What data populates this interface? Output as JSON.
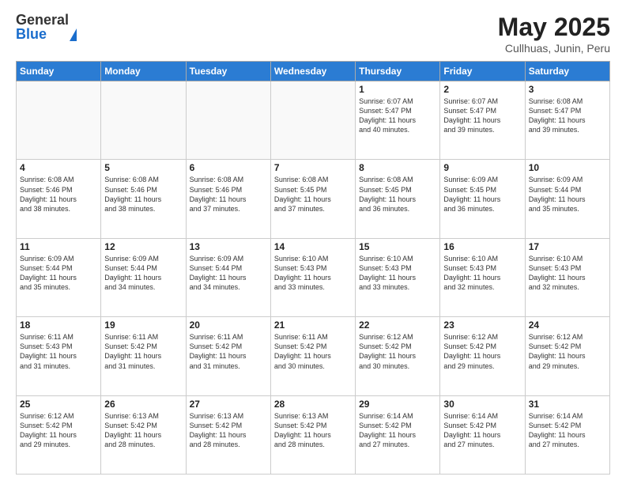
{
  "header": {
    "logo_general": "General",
    "logo_blue": "Blue",
    "month_title": "May 2025",
    "subtitle": "Cullhuas, Junin, Peru"
  },
  "days_of_week": [
    "Sunday",
    "Monday",
    "Tuesday",
    "Wednesday",
    "Thursday",
    "Friday",
    "Saturday"
  ],
  "weeks": [
    [
      {
        "day": "",
        "info": ""
      },
      {
        "day": "",
        "info": ""
      },
      {
        "day": "",
        "info": ""
      },
      {
        "day": "",
        "info": ""
      },
      {
        "day": "1",
        "info": "Sunrise: 6:07 AM\nSunset: 5:47 PM\nDaylight: 11 hours\nand 40 minutes."
      },
      {
        "day": "2",
        "info": "Sunrise: 6:07 AM\nSunset: 5:47 PM\nDaylight: 11 hours\nand 39 minutes."
      },
      {
        "day": "3",
        "info": "Sunrise: 6:08 AM\nSunset: 5:47 PM\nDaylight: 11 hours\nand 39 minutes."
      }
    ],
    [
      {
        "day": "4",
        "info": "Sunrise: 6:08 AM\nSunset: 5:46 PM\nDaylight: 11 hours\nand 38 minutes."
      },
      {
        "day": "5",
        "info": "Sunrise: 6:08 AM\nSunset: 5:46 PM\nDaylight: 11 hours\nand 38 minutes."
      },
      {
        "day": "6",
        "info": "Sunrise: 6:08 AM\nSunset: 5:46 PM\nDaylight: 11 hours\nand 37 minutes."
      },
      {
        "day": "7",
        "info": "Sunrise: 6:08 AM\nSunset: 5:45 PM\nDaylight: 11 hours\nand 37 minutes."
      },
      {
        "day": "8",
        "info": "Sunrise: 6:08 AM\nSunset: 5:45 PM\nDaylight: 11 hours\nand 36 minutes."
      },
      {
        "day": "9",
        "info": "Sunrise: 6:09 AM\nSunset: 5:45 PM\nDaylight: 11 hours\nand 36 minutes."
      },
      {
        "day": "10",
        "info": "Sunrise: 6:09 AM\nSunset: 5:44 PM\nDaylight: 11 hours\nand 35 minutes."
      }
    ],
    [
      {
        "day": "11",
        "info": "Sunrise: 6:09 AM\nSunset: 5:44 PM\nDaylight: 11 hours\nand 35 minutes."
      },
      {
        "day": "12",
        "info": "Sunrise: 6:09 AM\nSunset: 5:44 PM\nDaylight: 11 hours\nand 34 minutes."
      },
      {
        "day": "13",
        "info": "Sunrise: 6:09 AM\nSunset: 5:44 PM\nDaylight: 11 hours\nand 34 minutes."
      },
      {
        "day": "14",
        "info": "Sunrise: 6:10 AM\nSunset: 5:43 PM\nDaylight: 11 hours\nand 33 minutes."
      },
      {
        "day": "15",
        "info": "Sunrise: 6:10 AM\nSunset: 5:43 PM\nDaylight: 11 hours\nand 33 minutes."
      },
      {
        "day": "16",
        "info": "Sunrise: 6:10 AM\nSunset: 5:43 PM\nDaylight: 11 hours\nand 32 minutes."
      },
      {
        "day": "17",
        "info": "Sunrise: 6:10 AM\nSunset: 5:43 PM\nDaylight: 11 hours\nand 32 minutes."
      }
    ],
    [
      {
        "day": "18",
        "info": "Sunrise: 6:11 AM\nSunset: 5:43 PM\nDaylight: 11 hours\nand 31 minutes."
      },
      {
        "day": "19",
        "info": "Sunrise: 6:11 AM\nSunset: 5:42 PM\nDaylight: 11 hours\nand 31 minutes."
      },
      {
        "day": "20",
        "info": "Sunrise: 6:11 AM\nSunset: 5:42 PM\nDaylight: 11 hours\nand 31 minutes."
      },
      {
        "day": "21",
        "info": "Sunrise: 6:11 AM\nSunset: 5:42 PM\nDaylight: 11 hours\nand 30 minutes."
      },
      {
        "day": "22",
        "info": "Sunrise: 6:12 AM\nSunset: 5:42 PM\nDaylight: 11 hours\nand 30 minutes."
      },
      {
        "day": "23",
        "info": "Sunrise: 6:12 AM\nSunset: 5:42 PM\nDaylight: 11 hours\nand 29 minutes."
      },
      {
        "day": "24",
        "info": "Sunrise: 6:12 AM\nSunset: 5:42 PM\nDaylight: 11 hours\nand 29 minutes."
      }
    ],
    [
      {
        "day": "25",
        "info": "Sunrise: 6:12 AM\nSunset: 5:42 PM\nDaylight: 11 hours\nand 29 minutes."
      },
      {
        "day": "26",
        "info": "Sunrise: 6:13 AM\nSunset: 5:42 PM\nDaylight: 11 hours\nand 28 minutes."
      },
      {
        "day": "27",
        "info": "Sunrise: 6:13 AM\nSunset: 5:42 PM\nDaylight: 11 hours\nand 28 minutes."
      },
      {
        "day": "28",
        "info": "Sunrise: 6:13 AM\nSunset: 5:42 PM\nDaylight: 11 hours\nand 28 minutes."
      },
      {
        "day": "29",
        "info": "Sunrise: 6:14 AM\nSunset: 5:42 PM\nDaylight: 11 hours\nand 27 minutes."
      },
      {
        "day": "30",
        "info": "Sunrise: 6:14 AM\nSunset: 5:42 PM\nDaylight: 11 hours\nand 27 minutes."
      },
      {
        "day": "31",
        "info": "Sunrise: 6:14 AM\nSunset: 5:42 PM\nDaylight: 11 hours\nand 27 minutes."
      }
    ]
  ]
}
